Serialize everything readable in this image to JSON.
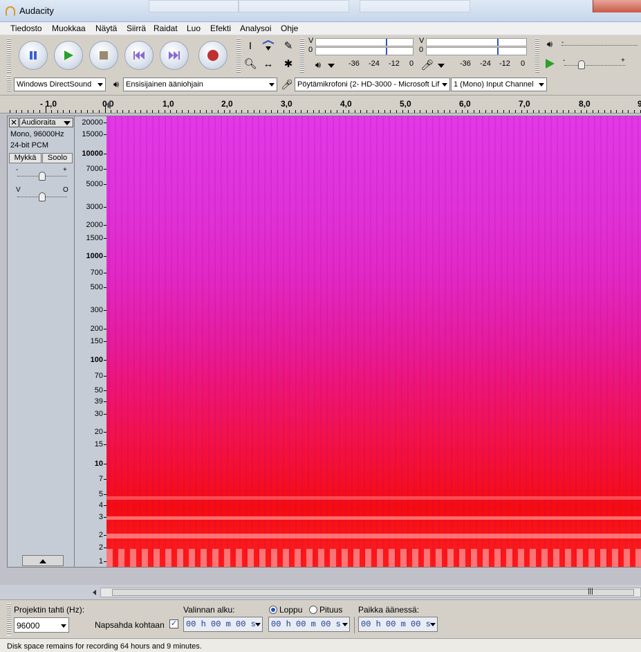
{
  "window": {
    "title": "Audacity"
  },
  "menu": [
    "Tiedosto",
    "Muokkaa",
    "Näytä",
    "Siirrä",
    "Raidat",
    "Luo",
    "Efekti",
    "Analysoi",
    "Ohje"
  ],
  "meters": {
    "playback_label": "V\n0",
    "record_label": "V\n0",
    "playback_ticks": [
      "-36",
      "-24",
      "-12",
      "0"
    ],
    "record_ticks": [
      "-36",
      "-24",
      "-12",
      "0"
    ]
  },
  "device": {
    "host": "Windows DirectSound",
    "output": "Ensisijainen ääniohjain",
    "input": "Pöytämikrofoni (2- HD-3000 - Microsoft Lif",
    "channels": "1 (Mono) Input Channel"
  },
  "ruler": {
    "labels": [
      "- 1,0",
      "0,0",
      "1,0",
      "2,0",
      "3,0",
      "4,0",
      "5,0",
      "6,0",
      "7,0",
      "8,0",
      "9"
    ]
  },
  "track": {
    "name": "Audioraita",
    "info1": "Mono, 96000Hz",
    "info2": "24-bit PCM",
    "mute": "Mykkä",
    "solo": "Soolo",
    "gain_minus": "-",
    "gain_plus": "+",
    "pan_left": "V",
    "pan_right": "O"
  },
  "freq_scale": [
    {
      "label": "20000",
      "bold": false
    },
    {
      "label": "15000",
      "bold": false
    },
    {
      "label": "10000",
      "bold": true
    },
    {
      "label": "7000",
      "bold": false
    },
    {
      "label": "5000",
      "bold": false
    },
    {
      "label": "3000",
      "bold": false
    },
    {
      "label": "2000",
      "bold": false
    },
    {
      "label": "1500",
      "bold": false
    },
    {
      "label": "1000",
      "bold": true
    },
    {
      "label": "700",
      "bold": false
    },
    {
      "label": "500",
      "bold": false
    },
    {
      "label": "300",
      "bold": false
    },
    {
      "label": "200",
      "bold": false
    },
    {
      "label": "150",
      "bold": false
    },
    {
      "label": "100",
      "bold": true
    },
    {
      "label": "70",
      "bold": false
    },
    {
      "label": "50",
      "bold": false
    },
    {
      "label": "39",
      "bold": false
    },
    {
      "label": "30",
      "bold": false
    },
    {
      "label": "20",
      "bold": false
    },
    {
      "label": "15",
      "bold": false
    },
    {
      "label": "10",
      "bold": true
    },
    {
      "label": "7",
      "bold": false
    },
    {
      "label": "5",
      "bold": false
    },
    {
      "label": "4",
      "bold": false
    },
    {
      "label": "3",
      "bold": false
    },
    {
      "label": "2",
      "bold": false
    },
    {
      "label": "2",
      "bold": false
    },
    {
      "label": "1",
      "bold": false
    }
  ],
  "selection": {
    "rate_label": "Projektin tahti (Hz):",
    "rate_value": "96000",
    "snap_label": "Napsahda kohtaan",
    "start_label": "Valinnan alku:",
    "end_label": "Loppu",
    "length_label": "Pituus",
    "position_label": "Paikka äänessä:",
    "time_value": "00 h 00 m 00 s"
  },
  "status": "Disk space remains for recording 64 hours and 9 minutes.",
  "colors": {
    "pause": "#3a5fd0",
    "play": "#2aa02a",
    "stop": "#8a8a8a",
    "skip": "#8a6ad0",
    "record": "#c03030"
  }
}
